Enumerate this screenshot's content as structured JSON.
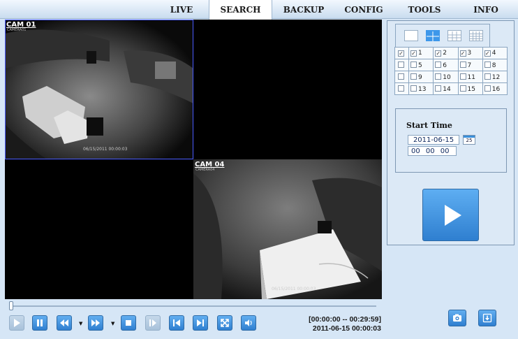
{
  "nav": {
    "tabs": [
      "LIVE",
      "SEARCH",
      "BACKUP",
      "CONFIG",
      "TOOLS",
      "INFO"
    ],
    "active": "SEARCH"
  },
  "cameras": [
    {
      "label": "CAM 01",
      "sub": "CAMERA01",
      "stamp": "06/15/2011 00:00:03"
    },
    {
      "label": "CAM 04",
      "sub": "CAMERA04",
      "stamp": "06/15/2011 00:00:03"
    }
  ],
  "channels": {
    "rows": [
      [
        {
          "n": "1",
          "checked": true
        },
        {
          "n": "2",
          "checked": true
        },
        {
          "n": "3",
          "checked": true
        },
        {
          "n": "4",
          "checked": true
        }
      ],
      [
        {
          "n": "5",
          "checked": false
        },
        {
          "n": "6",
          "checked": false
        },
        {
          "n": "7",
          "checked": false
        },
        {
          "n": "8",
          "checked": false
        }
      ],
      [
        {
          "n": "9",
          "checked": false
        },
        {
          "n": "10",
          "checked": false
        },
        {
          "n": "11",
          "checked": false
        },
        {
          "n": "12",
          "checked": false
        }
      ],
      [
        {
          "n": "13",
          "checked": false
        },
        {
          "n": "14",
          "checked": false
        },
        {
          "n": "15",
          "checked": false
        },
        {
          "n": "16",
          "checked": false
        }
      ]
    ],
    "row_selected": [
      true,
      false,
      false,
      false
    ]
  },
  "search": {
    "start_time_label": "Start Time",
    "date": "2011-06-15",
    "calendar_day": "25",
    "time": "00 00 00"
  },
  "playback": {
    "range": "[00:00:00 -- 00:29:59]",
    "current": "2011-06-15 00:00:03",
    "progress": 0.0
  },
  "colors": {
    "accent": "#3d97ea",
    "background": "#d6e6f6"
  }
}
